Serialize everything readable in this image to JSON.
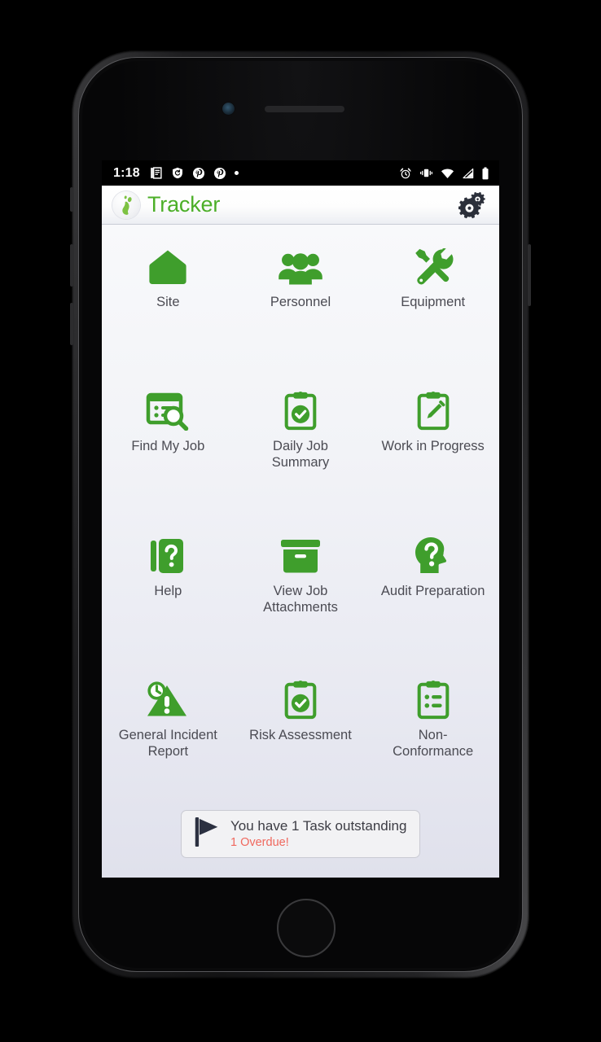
{
  "colors": {
    "brand_green": "#4caf28",
    "icon_green": "#3f9e2c",
    "label_gray": "#4b4b53",
    "overdue_red": "#f0685e",
    "status_bar_bg": "#000000"
  },
  "status_bar": {
    "clock": "1:18",
    "left_icons": [
      "news-article-icon",
      "shield-icon",
      "pinterest-icon",
      "pinterest-icon",
      "dot-icon"
    ],
    "right_icons": [
      "alarm-clock-icon",
      "vibrate-icon",
      "wifi-icon",
      "cellular-signal-icon",
      "battery-icon"
    ]
  },
  "header": {
    "logo_icon": "footprint-logo-icon",
    "title": "Tracker",
    "settings_icon": "gears-settings-icon"
  },
  "grid": {
    "tiles": [
      {
        "label": "Site",
        "icon": "house-icon"
      },
      {
        "label": "Personnel",
        "icon": "people-group-icon"
      },
      {
        "label": "Equipment",
        "icon": "wrench-screwdriver-icon"
      },
      {
        "label": "Find My Job",
        "icon": "list-search-icon"
      },
      {
        "label": "Daily Job Summary",
        "icon": "clipboard-check-icon"
      },
      {
        "label": "Work in Progress",
        "icon": "clipboard-pencil-icon"
      },
      {
        "label": "Help",
        "icon": "book-question-icon"
      },
      {
        "label": "View Job Attachments",
        "icon": "archive-box-icon"
      },
      {
        "label": "Audit Preparation",
        "icon": "head-question-icon"
      },
      {
        "label": "General Incident Report",
        "icon": "warning-clock-icon"
      },
      {
        "label": "Risk Assessment",
        "icon": "clipboard-check-icon"
      },
      {
        "label": "Non-Conformance",
        "icon": "clipboard-list-icon"
      }
    ]
  },
  "banner": {
    "icon": "flag-icon",
    "message": "You have 1 Task outstanding",
    "overdue": "1 Overdue!"
  }
}
